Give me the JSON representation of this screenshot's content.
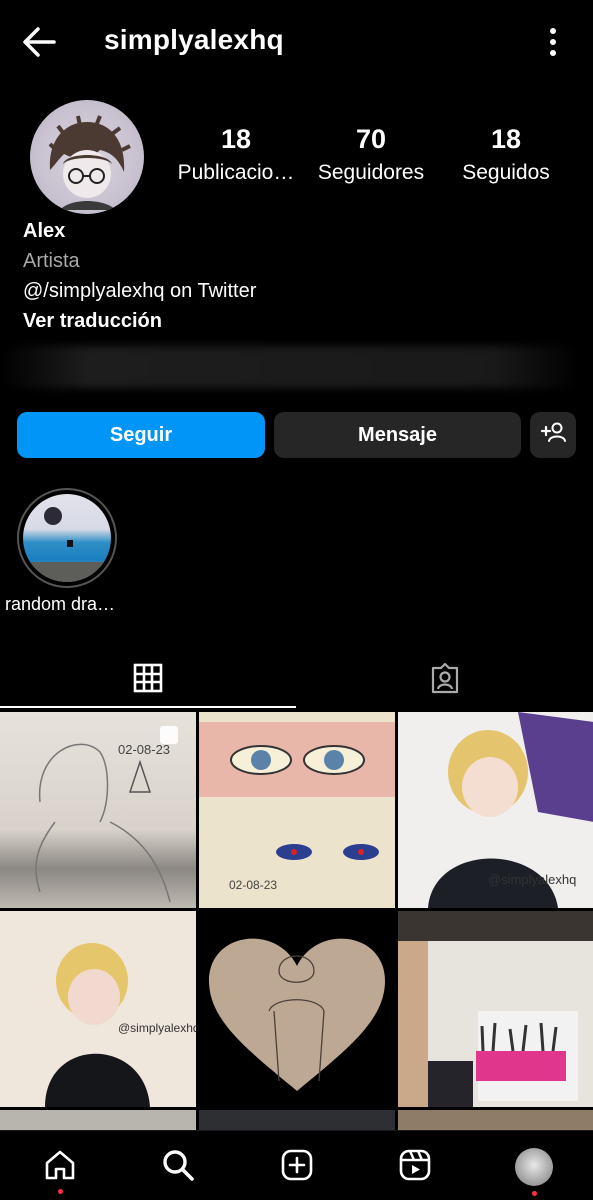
{
  "header": {
    "username": "simplyalexhq"
  },
  "profile": {
    "stats": [
      {
        "value": "18",
        "label": "Publicacio…"
      },
      {
        "value": "70",
        "label": "Seguidores"
      },
      {
        "value": "18",
        "label": "Seguidos"
      }
    ],
    "name": "Alex",
    "category": "Artista",
    "bio_line": "@/simplyalexhq on Twitter",
    "translate_label": "Ver traducción"
  },
  "actions": {
    "follow_label": "Seguir",
    "message_label": "Mensaje",
    "add_user_icon": "add-user-icon"
  },
  "highlights": [
    {
      "label": "random dra…"
    }
  ],
  "tabs": [
    {
      "icon": "grid-icon",
      "active": true
    },
    {
      "icon": "tagged-icon",
      "active": false
    }
  ],
  "posts": [
    {
      "caption": "02-08-23",
      "theme": "pencil-sketch"
    },
    {
      "caption": "02-08-23",
      "theme": "eyes"
    },
    {
      "caption": "@simplyalexhq",
      "theme": "blonde-portrait"
    },
    {
      "caption": "@simplyalexhq",
      "theme": "blonde-sweater"
    },
    {
      "caption": "",
      "theme": "heart-sketch"
    },
    {
      "caption": "",
      "theme": "art-supplies"
    }
  ],
  "nav": [
    "home-icon",
    "search-icon",
    "create-icon",
    "reels-icon",
    "profile-avatar"
  ],
  "colors": {
    "accent": "#0095f6",
    "button_dark": "#262626",
    "notification_dot": "#ff3040"
  }
}
